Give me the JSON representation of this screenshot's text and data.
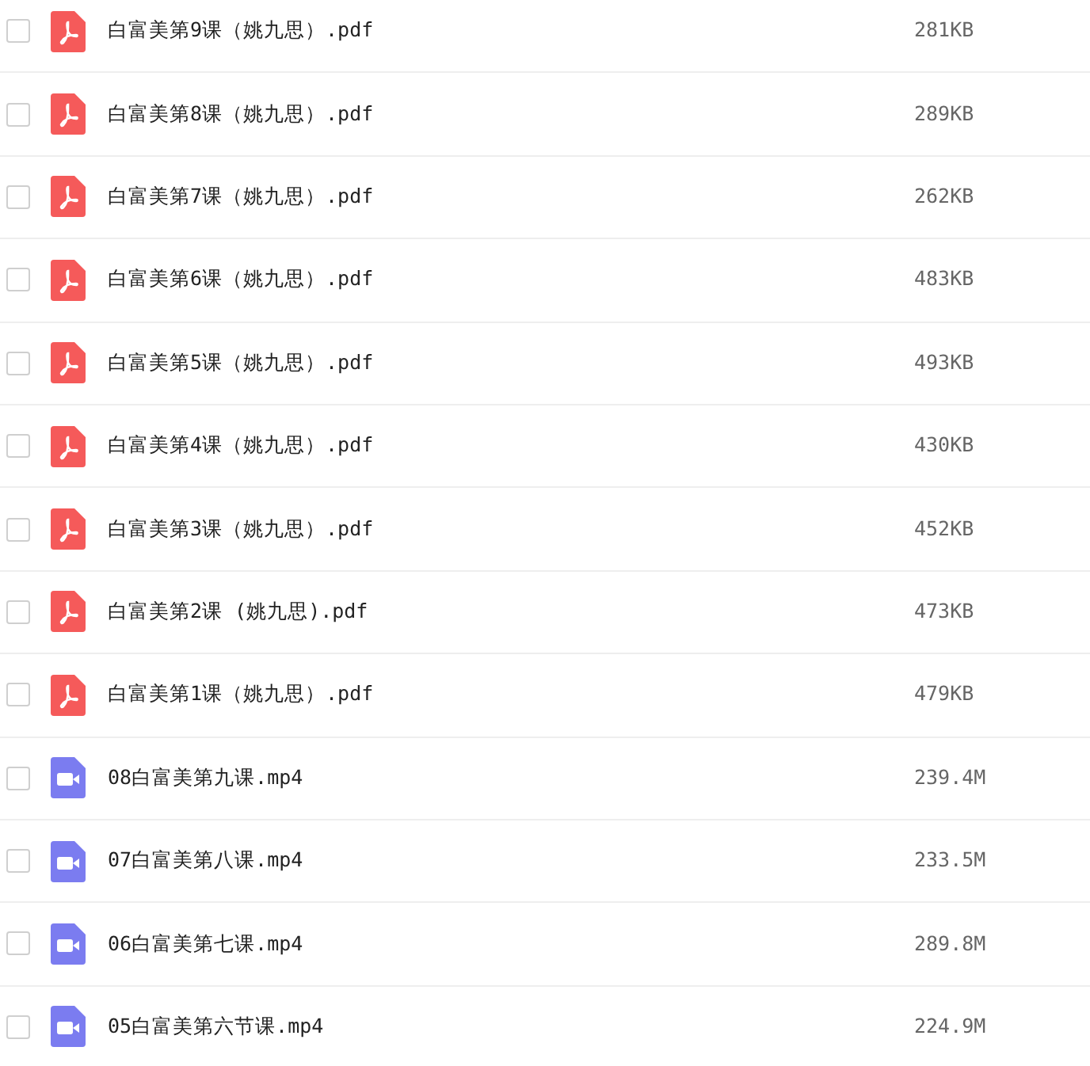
{
  "files": [
    {
      "kind": "pdf",
      "name": "白富美第9课（姚九思）.pdf",
      "size": "281KB",
      "checked": false
    },
    {
      "kind": "pdf",
      "name": "白富美第8课（姚九思）.pdf",
      "size": "289KB",
      "checked": false
    },
    {
      "kind": "pdf",
      "name": "白富美第7课（姚九思）.pdf",
      "size": "262KB",
      "checked": false
    },
    {
      "kind": "pdf",
      "name": "白富美第6课（姚九思）.pdf",
      "size": "483KB",
      "checked": false
    },
    {
      "kind": "pdf",
      "name": "白富美第5课（姚九思）.pdf",
      "size": "493KB",
      "checked": false
    },
    {
      "kind": "pdf",
      "name": "白富美第4课（姚九思）.pdf",
      "size": "430KB",
      "checked": false
    },
    {
      "kind": "pdf",
      "name": "白富美第3课（姚九思）.pdf",
      "size": "452KB",
      "checked": false
    },
    {
      "kind": "pdf",
      "name": "白富美第2课 (姚九思).pdf",
      "size": "473KB",
      "checked": false
    },
    {
      "kind": "pdf",
      "name": "白富美第1课（姚九思）.pdf",
      "size": "479KB",
      "checked": false
    },
    {
      "kind": "video",
      "name": "08白富美第九课.mp4",
      "size": "239.4M",
      "checked": false
    },
    {
      "kind": "video",
      "name": "07白富美第八课.mp4",
      "size": "233.5M",
      "checked": false
    },
    {
      "kind": "video",
      "name": "06白富美第七课.mp4",
      "size": "289.8M",
      "checked": false
    },
    {
      "kind": "video",
      "name": "05白富美第六节课.mp4",
      "size": "224.9M",
      "checked": false
    }
  ]
}
